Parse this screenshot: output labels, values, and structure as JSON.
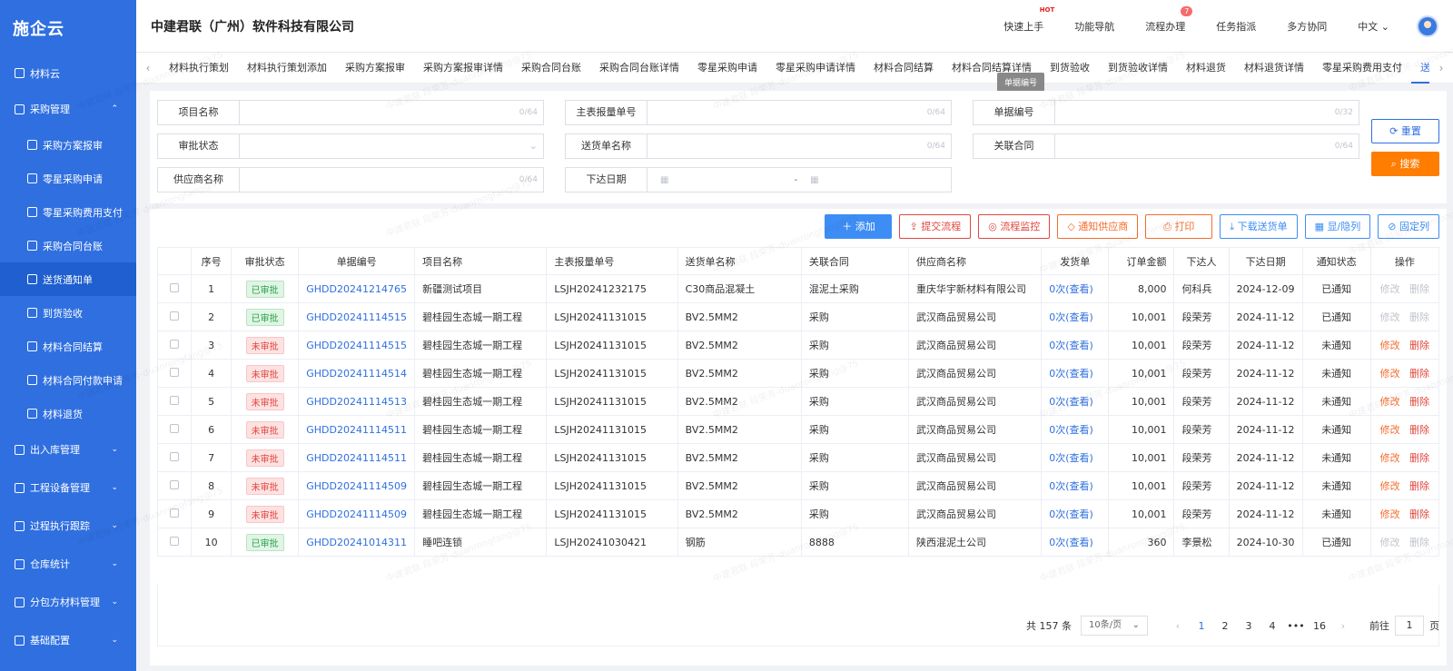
{
  "sidebar": {
    "logo": "施企云",
    "items": [
      {
        "label": "材料云",
        "type": "top"
      },
      {
        "label": "采购管理",
        "type": "group",
        "expanded": true
      },
      {
        "label": "采购方案报审",
        "type": "child"
      },
      {
        "label": "零星采购申请",
        "type": "child"
      },
      {
        "label": "零星采购费用支付",
        "type": "child"
      },
      {
        "label": "采购合同台账",
        "type": "child"
      },
      {
        "label": "送货通知单",
        "type": "child",
        "active": true
      },
      {
        "label": "到货验收",
        "type": "child"
      },
      {
        "label": "材料合同结算",
        "type": "child"
      },
      {
        "label": "材料合同付款申请",
        "type": "child"
      },
      {
        "label": "材料退货",
        "type": "child"
      },
      {
        "label": "出入库管理",
        "type": "group"
      },
      {
        "label": "工程设备管理",
        "type": "group"
      },
      {
        "label": "过程执行跟踪",
        "type": "group"
      },
      {
        "label": "仓库统计",
        "type": "group"
      },
      {
        "label": "分包方材料管理",
        "type": "group"
      },
      {
        "label": "基础配置",
        "type": "group"
      }
    ]
  },
  "header": {
    "company": "中建君联（广州）软件科技有限公司",
    "links": [
      "快速上手",
      "功能导航",
      "流程办理",
      "任务指派",
      "多方协同"
    ],
    "hot_label": "HOT",
    "flow_badge": "7",
    "lang": "中文"
  },
  "tabs": [
    "材料执行策划",
    "材料执行策划添加",
    "采购方案报审",
    "采购方案报审详情",
    "采购合同台账",
    "采购合同台账详情",
    "零星采购申请",
    "零星采购申请详情",
    "材料合同结算",
    "材料合同结算详情",
    "到货验收",
    "到货验收详情",
    "材料退货",
    "材料退货详情",
    "零星采购费用支付",
    "送货通知"
  ],
  "tooltip": "单据编号",
  "filters": {
    "project_name": "项目名称",
    "main_report_no": "主表报量单号",
    "doc_no": "单据编号",
    "approval_status": "审批状态",
    "delivery_name": "送货单名称",
    "related_contract": "关联合同",
    "supplier_name": "供应商名称",
    "issue_date": "下达日期",
    "count_64": "0/64",
    "count_32": "0/32",
    "date_sep": "-"
  },
  "buttons": {
    "reset": "重置",
    "search": "搜索",
    "add": "添加",
    "submit_flow": "提交流程",
    "flow_monitor": "流程监控",
    "notify_supplier": "通知供应商",
    "print": "打印",
    "download": "下载送货单",
    "show_hide": "显/隐列",
    "fix_col": "固定列"
  },
  "table": {
    "headers": [
      "序号",
      "审批状态",
      "单据编号",
      "项目名称",
      "主表报量单号",
      "送货单名称",
      "关联合同",
      "供应商名称",
      "发货单",
      "订单金额",
      "下达人",
      "下达日期",
      "通知状态",
      "操作"
    ],
    "edit": "修改",
    "delete": "删除",
    "rows": [
      {
        "no": "1",
        "status": "已审批",
        "ok": true,
        "doc": "GHDD20241214765",
        "project": "新疆测试项目",
        "report": "LSJH20241232175",
        "delivery": "C30商品混凝土",
        "contract": "混泥土采购",
        "supplier": "重庆华宇新材料有限公司",
        "ship": "0次(查看)",
        "amount": "8,000",
        "person": "何科兵",
        "date": "2024-12-09",
        "notify": "已通知"
      },
      {
        "no": "2",
        "status": "已审批",
        "ok": true,
        "doc": "GHDD20241114515",
        "project": "碧桂园生态城一期工程",
        "report": "LSJH20241131015",
        "delivery": "BV2.5MM2",
        "contract": "采购",
        "supplier": "武汉商品贸易公司",
        "ship": "0次(查看)",
        "amount": "10,001",
        "person": "段荣芳",
        "date": "2024-11-12",
        "notify": "已通知"
      },
      {
        "no": "3",
        "status": "未审批",
        "ok": false,
        "doc": "GHDD20241114515",
        "project": "碧桂园生态城一期工程",
        "report": "LSJH20241131015",
        "delivery": "BV2.5MM2",
        "contract": "采购",
        "supplier": "武汉商品贸易公司",
        "ship": "0次(查看)",
        "amount": "10,001",
        "person": "段荣芳",
        "date": "2024-11-12",
        "notify": "未通知"
      },
      {
        "no": "4",
        "status": "未审批",
        "ok": false,
        "doc": "GHDD20241114514",
        "project": "碧桂园生态城一期工程",
        "report": "LSJH20241131015",
        "delivery": "BV2.5MM2",
        "contract": "采购",
        "supplier": "武汉商品贸易公司",
        "ship": "0次(查看)",
        "amount": "10,001",
        "person": "段荣芳",
        "date": "2024-11-12",
        "notify": "未通知"
      },
      {
        "no": "5",
        "status": "未审批",
        "ok": false,
        "doc": "GHDD20241114513",
        "project": "碧桂园生态城一期工程",
        "report": "LSJH20241131015",
        "delivery": "BV2.5MM2",
        "contract": "采购",
        "supplier": "武汉商品贸易公司",
        "ship": "0次(查看)",
        "amount": "10,001",
        "person": "段荣芳",
        "date": "2024-11-12",
        "notify": "未通知"
      },
      {
        "no": "6",
        "status": "未审批",
        "ok": false,
        "doc": "GHDD20241114511",
        "project": "碧桂园生态城一期工程",
        "report": "LSJH20241131015",
        "delivery": "BV2.5MM2",
        "contract": "采购",
        "supplier": "武汉商品贸易公司",
        "ship": "0次(查看)",
        "amount": "10,001",
        "person": "段荣芳",
        "date": "2024-11-12",
        "notify": "未通知"
      },
      {
        "no": "7",
        "status": "未审批",
        "ok": false,
        "doc": "GHDD20241114511",
        "project": "碧桂园生态城一期工程",
        "report": "LSJH20241131015",
        "delivery": "BV2.5MM2",
        "contract": "采购",
        "supplier": "武汉商品贸易公司",
        "ship": "0次(查看)",
        "amount": "10,001",
        "person": "段荣芳",
        "date": "2024-11-12",
        "notify": "未通知"
      },
      {
        "no": "8",
        "status": "未审批",
        "ok": false,
        "doc": "GHDD20241114509",
        "project": "碧桂园生态城一期工程",
        "report": "LSJH20241131015",
        "delivery": "BV2.5MM2",
        "contract": "采购",
        "supplier": "武汉商品贸易公司",
        "ship": "0次(查看)",
        "amount": "10,001",
        "person": "段荣芳",
        "date": "2024-11-12",
        "notify": "未通知"
      },
      {
        "no": "9",
        "status": "未审批",
        "ok": false,
        "doc": "GHDD20241114509",
        "project": "碧桂园生态城一期工程",
        "report": "LSJH20241131015",
        "delivery": "BV2.5MM2",
        "contract": "采购",
        "supplier": "武汉商品贸易公司",
        "ship": "0次(查看)",
        "amount": "10,001",
        "person": "段荣芳",
        "date": "2024-11-12",
        "notify": "未通知"
      },
      {
        "no": "10",
        "status": "已审批",
        "ok": true,
        "doc": "GHDD20241014311",
        "project": "睡吧连锁",
        "report": "LSJH20241030421",
        "delivery": "钢筋",
        "contract": "8888",
        "supplier": "陕西混泥土公司",
        "ship": "0次(查看)",
        "amount": "360",
        "person": "李景松",
        "date": "2024-10-30",
        "notify": "已通知"
      }
    ]
  },
  "pager": {
    "total": "共 157 条",
    "per_page": "10条/页",
    "pages": [
      "1",
      "2",
      "3",
      "4",
      "•••",
      "16"
    ],
    "current": "1",
    "goto_prefix": "前往",
    "goto_value": "1",
    "goto_suffix": "页"
  },
  "watermark": "中建君联 段荣芳-duanrongfang@75"
}
